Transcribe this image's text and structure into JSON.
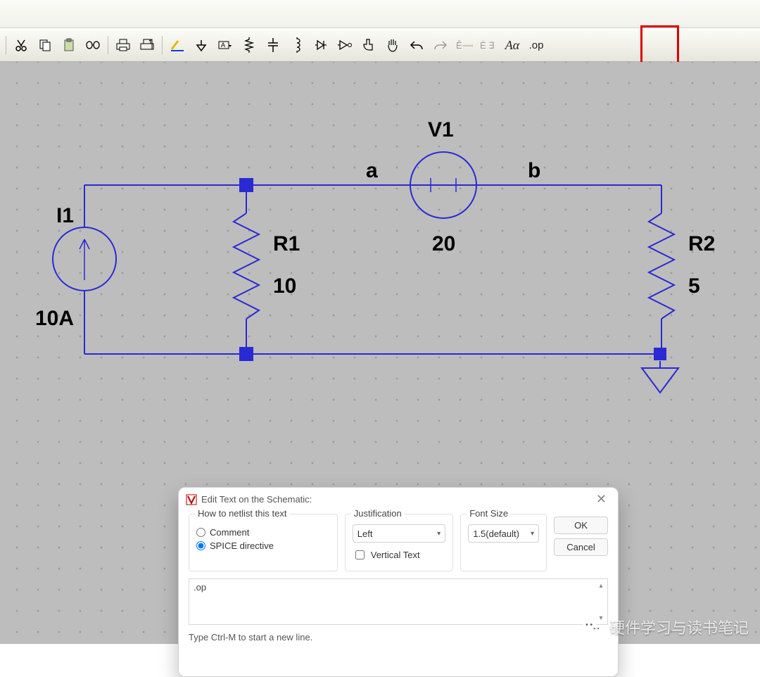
{
  "circuit": {
    "I1": {
      "name": "I1",
      "value": "10A"
    },
    "R1": {
      "name": "R1",
      "value": "10"
    },
    "V1": {
      "name": "V1",
      "value": "20"
    },
    "R2": {
      "name": "R2",
      "value": "5"
    },
    "node_a": "a",
    "node_b": "b"
  },
  "dialog": {
    "title": "Edit Text on the Schematic:",
    "netlist_label": "How to netlist this text",
    "opt_comment": "Comment",
    "opt_spice": "SPICE directive",
    "justification_label": "Justification",
    "justification_value": "Left",
    "vertical_text_label": "Vertical Text",
    "fontsize_label": "Font Size",
    "fontsize_value": "1.5(default)",
    "ok": "OK",
    "cancel": "Cancel",
    "textarea_value": ".op",
    "footer": "Type Ctrl-M to start a new line."
  },
  "toolbar_op_label": ".op",
  "watermark_text": "硬件学习与读书笔记"
}
